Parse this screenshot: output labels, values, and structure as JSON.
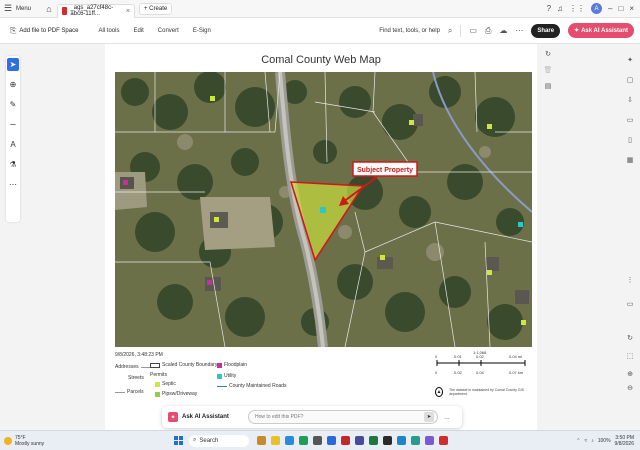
{
  "titlebar": {
    "menu_label": "Menu",
    "tab_title": "_ags_a27cf48c-abc6-11ff...",
    "new_tab_label": "+ Create"
  },
  "toolbar": {
    "add_file_label": "Add file to PDF Space",
    "menus": [
      "All tools",
      "Edit",
      "Convert",
      "E-Sign"
    ],
    "search_placeholder": "Find text, tools, or help",
    "share_label": "Share",
    "ai_assistant_label": "Ask AI Assistant"
  },
  "document": {
    "map_title": "Comal County Web Map",
    "callout_label": "Subject Property",
    "timestamp": "9/8/2026, 3:48:23 PM",
    "legend": {
      "addresses": "Addresses",
      "streets": "Streets",
      "parcels": "Parcels",
      "scaled_county_boundary": "Scaled County Boundary",
      "permits": "Permits",
      "septic": "Septic",
      "pipsw_driveway": "Pipsw/Driveway",
      "floodplain": "Floodplain",
      "utility": "Utility",
      "county_maintained_roads": "County Maintained Roads"
    },
    "scale": {
      "ratio": "1:1,068",
      "top_ticks": [
        "0",
        "0.01",
        "0.02",
        "0.04 mi"
      ],
      "bottom_ticks": [
        "0",
        "0.02",
        "0.04",
        "0.07 km"
      ]
    },
    "disclaimer": "The dataset is maintained by Comal County GIS department."
  },
  "ai_bar": {
    "title": "Ask AI Assistant",
    "placeholder": "How to edit this PDF?",
    "more": "..."
  },
  "taskbar": {
    "temperature": "75°F",
    "weather": "Mostly sunny",
    "search_label": "Search",
    "time": "3:50 PM",
    "date": "9/8/2026",
    "battery": "100%"
  },
  "colors": {
    "accent_blue": "#2f6fe0",
    "ai_pink": "#e44d6e",
    "callout_red": "#d01818",
    "property_fill": "#cfe63a"
  }
}
